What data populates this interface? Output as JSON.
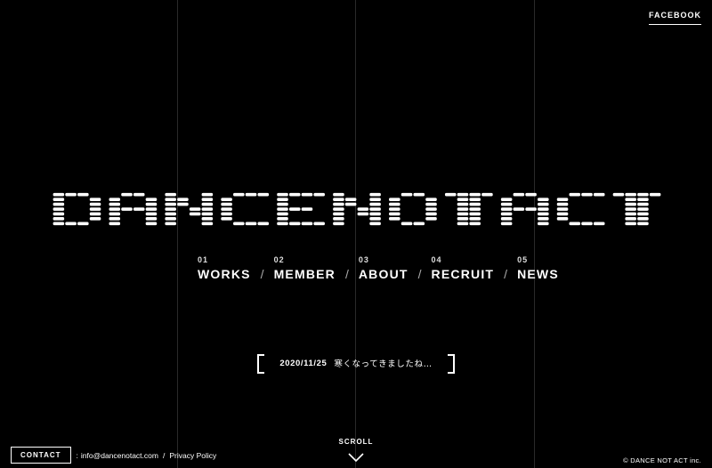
{
  "header": {
    "facebook_label": "FACEBOOK"
  },
  "logo": {
    "text": "DANCENOTACT"
  },
  "nav": [
    {
      "num": "01",
      "label": "WORKS"
    },
    {
      "num": "02",
      "label": "MEMBER"
    },
    {
      "num": "03",
      "label": "ABOUT"
    },
    {
      "num": "04",
      "label": "RECRUIT"
    },
    {
      "num": "05",
      "label": "NEWS"
    }
  ],
  "nav_separator": "/",
  "news": {
    "date": "2020/11/25",
    "text": "寒くなってきましたね…"
  },
  "scroll": {
    "label": "SCROLL"
  },
  "footer": {
    "contact_label": "CONTACT",
    "colon": ":",
    "email": "info@dancenotact.com",
    "slash": "/",
    "privacy": "Privacy Policy",
    "copyright": "© DANCE NOT ACT inc."
  },
  "colors": {
    "background": "#000000",
    "foreground": "#ffffff",
    "grid_line": "#2a2a2a"
  },
  "icons": {
    "scroll": "chevron-down-icon"
  }
}
